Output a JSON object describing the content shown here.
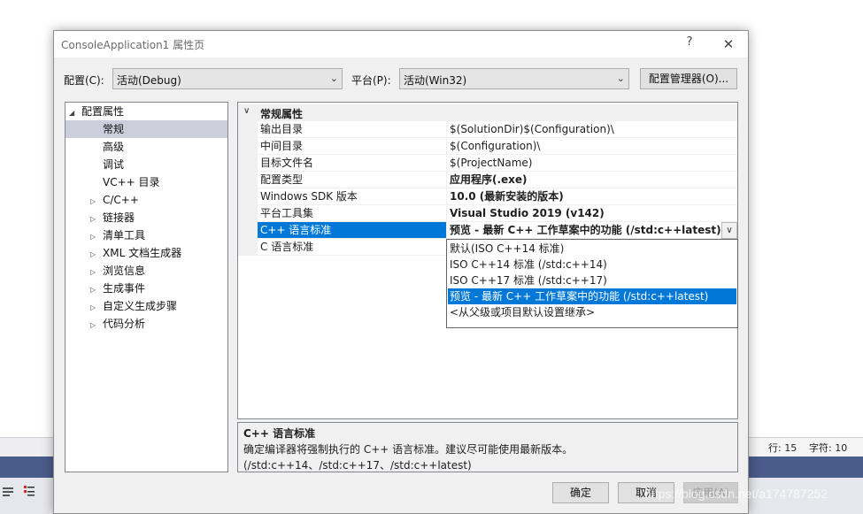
{
  "background": {
    "status": {
      "line": "行: 15",
      "col": "字符: 10"
    }
  },
  "dialog": {
    "title": "ConsoleApplication1 属性页",
    "help": "?",
    "close": "✕",
    "config_label": "配置(C):",
    "config_value": "活动(Debug)",
    "platform_label": "平台(P):",
    "platform_value": "活动(Win32)",
    "config_manager": "配置管理器(O)...",
    "tree": {
      "root": "配置属性",
      "items": [
        "常规",
        "高级",
        "调试",
        "VC++ 目录"
      ],
      "collapsed": [
        "C/C++",
        "链接器",
        "清单工具",
        "XML 文档生成器",
        "浏览信息",
        "生成事件",
        "自定义生成步骤",
        "代码分析"
      ]
    },
    "grid": {
      "category": "常规属性",
      "rows": [
        {
          "name": "输出目录",
          "value": "$(SolutionDir)$(Configuration)\\"
        },
        {
          "name": "中间目录",
          "value": "$(Configuration)\\"
        },
        {
          "name": "目标文件名",
          "value": "$(ProjectName)"
        },
        {
          "name": "配置类型",
          "value": "应用程序(.exe)"
        },
        {
          "name": "Windows SDK 版本",
          "value": "10.0 (最新安装的版本)"
        },
        {
          "name": "平台工具集",
          "value": "Visual Studio 2019 (v142)"
        },
        {
          "name": "C++ 语言标准",
          "value": "预览 - 最新 C++ 工作草案中的功能 (/std:c++latest)"
        },
        {
          "name": "C 语言标准",
          "value": ""
        }
      ],
      "dropdown_options": [
        "默认(ISO C++14 标准)",
        "ISO C++14 标准 (/std:c++14)",
        "ISO C++17 标准 (/std:c++17)",
        "预览 - 最新 C++ 工作草案中的功能 (/std:c++latest)",
        "<从父级或项目默认设置继承>"
      ]
    },
    "description": {
      "title": "C++ 语言标准",
      "text": "确定编译器将强制执行的 C++ 语言标准。建议尽可能使用最新版本。(/std:c++14、/std:c++17、/std:c++latest)"
    },
    "buttons": {
      "ok": "确定",
      "cancel": "取消",
      "apply": "应用(A)"
    }
  },
  "watermark": "https://blog.csdn.net/a174787252",
  "colors": {
    "selection": "#0078d7",
    "tree_selection": "#cccedb",
    "ide_band": "#4a5c8a"
  }
}
